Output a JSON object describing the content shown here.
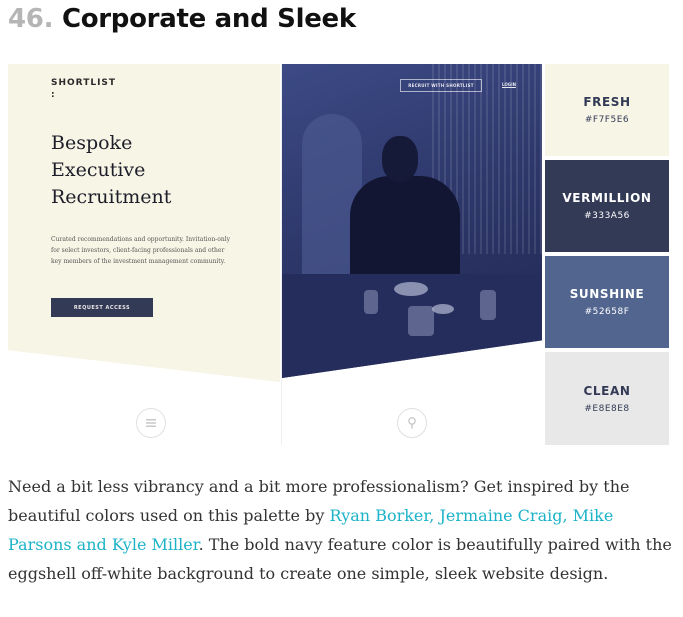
{
  "heading": {
    "number": "46.",
    "title": "Corporate and Sleek"
  },
  "mockup": {
    "logo": "SHORTLIST",
    "logo_mark": ":",
    "hero_title_line1": "Bespoke",
    "hero_title_line2": "Executive",
    "hero_title_line3": "Recruitment",
    "hero_copy": "Curated recommendations and opportunity. Invitation-only for select investors, client-facing professionals and other key members of the investment management community.",
    "request_button": "REQUEST ACCESS",
    "recruit_button": "RECRUIT WITH SHORTLIST",
    "login_link": "LOGIN",
    "menu_icon": "menu-icon",
    "lock_icon": "lock-icon"
  },
  "swatches": [
    {
      "name": "FRESH",
      "hex": "#F7F5E6"
    },
    {
      "name": "VERMILLION",
      "hex": "#333A56"
    },
    {
      "name": "SUNSHINE",
      "hex": "#52658F"
    },
    {
      "name": "CLEAN",
      "hex": "#E8E8E8"
    }
  ],
  "colors": {
    "link": "#1cb3c8",
    "navy": "#333a56",
    "eggshell": "#f7f5e6"
  },
  "description": {
    "text_before": "Need a bit less vibrancy and a bit more professionalism? Get inspired by the beautiful colors used on this palette by ",
    "link_text": "Ryan Borker, Jermaine Craig, Mike Parsons and Kyle Miller",
    "text_after": ". The bold navy feature color is beautifully paired with the eggshell off-white background to create one simple, sleek website design."
  }
}
